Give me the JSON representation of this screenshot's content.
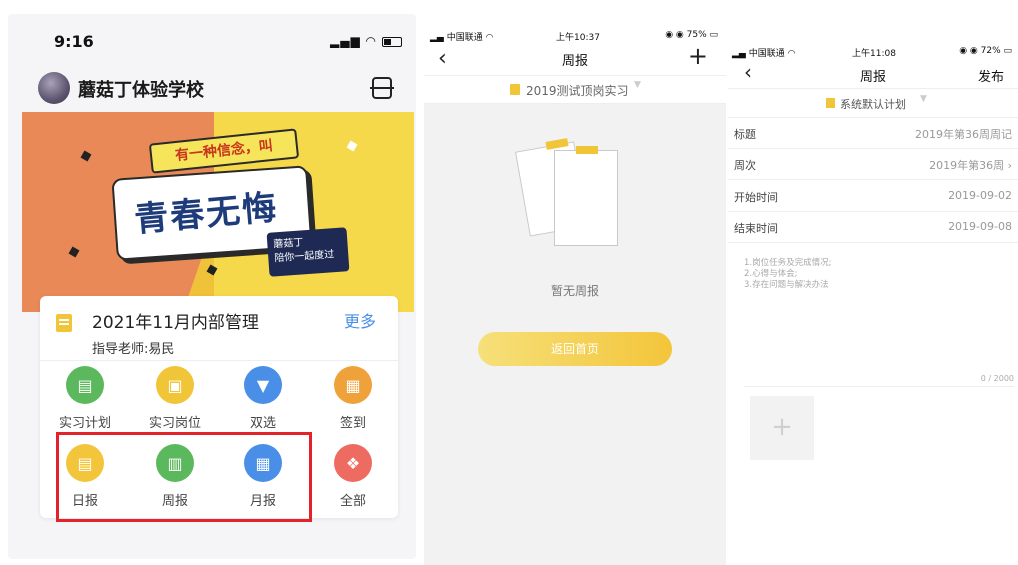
{
  "panel1": {
    "status": {
      "time": "9:16",
      "signal": "▂▄▆ ◠"
    },
    "school_name": "蘑菇丁体验学校",
    "banner": {
      "headline": "有一种信念，叫",
      "slogan": "青春无悔",
      "tag_title": "蘑菇丁",
      "tag_sub": "陪你一起度过"
    },
    "card": {
      "title": "2021年11月内部管理",
      "more": "更多",
      "teacher": "指导老师:易民"
    },
    "grid": [
      {
        "label": "实习计划",
        "color": "#5cb85c",
        "icon": "plan-icon",
        "glyph": "▤"
      },
      {
        "label": "实习岗位",
        "color": "#f0c537",
        "icon": "briefcase-icon",
        "glyph": "▣"
      },
      {
        "label": "双选",
        "color": "#4a8fe7",
        "icon": "tie-icon",
        "glyph": "▼"
      },
      {
        "label": "签到",
        "color": "#f0a23a",
        "icon": "calendar-icon",
        "glyph": "▦"
      },
      {
        "label": "日报",
        "color": "#f3c53a",
        "icon": "daily-report-icon",
        "glyph": "▤"
      },
      {
        "label": "周报",
        "color": "#5cb85c",
        "icon": "weekly-report-icon",
        "glyph": "▥"
      },
      {
        "label": "月报",
        "color": "#4a8fe7",
        "icon": "monthly-report-icon",
        "glyph": "▦"
      },
      {
        "label": "全部",
        "color": "#ee6b61",
        "icon": "all-apps-icon",
        "glyph": "❖"
      }
    ]
  },
  "panel2": {
    "status": {
      "carrier": "▂▄ 中国联通 ◠",
      "time": "上午10:37",
      "battery": "◉ ◉ 75% ▭"
    },
    "nav": {
      "back": "‹",
      "title": "周报",
      "plus": "+"
    },
    "plan": {
      "label": "2019测试顶岗实习",
      "caret": "▼"
    },
    "empty_text": "暂无周报",
    "home_button": "返回首页"
  },
  "panel3": {
    "status": {
      "carrier": "▂▄ 中国联通 ◠",
      "time": "上午11:08",
      "battery": "◉ ◉ 72% ▭"
    },
    "nav": {
      "back": "‹",
      "title": "周报",
      "publish": "发布"
    },
    "plan": {
      "label": "系统默认计划",
      "caret": "▼"
    },
    "fields": [
      {
        "label": "标题",
        "value": "2019年第36周周记"
      },
      {
        "label": "周次",
        "value": "2019年第36周 ›"
      },
      {
        "label": "开始时间",
        "value": "2019-09-02"
      },
      {
        "label": "结束时间",
        "value": "2019-09-08"
      }
    ],
    "hint": "1.岗位任务及完成情况;\n2.心得与体会;\n3.存在问题与解决办法",
    "counter": "0 / 2000",
    "add_glyph": "+"
  },
  "colors": {
    "accent_yellow": "#f0c537",
    "link_blue": "#4a8fe7",
    "highlight_red": "#e2242a"
  }
}
